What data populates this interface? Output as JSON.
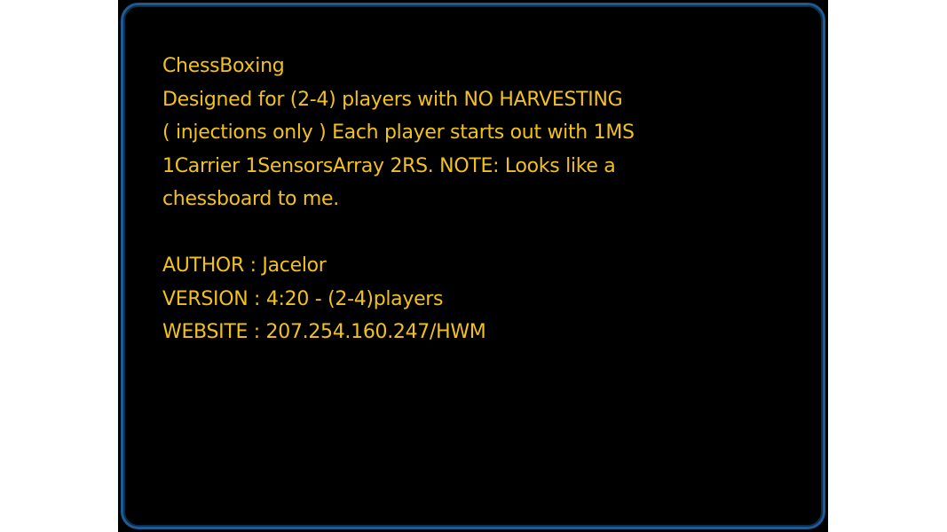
{
  "map_info": {
    "title": "ChessBoxing",
    "description_lines": [
      "Designed for (2-4) players with NO HARVESTING",
      "( injections only ) Each player starts out with 1MS",
      "1Carrier 1SensorsArray 2RS. NOTE: Looks like a",
      "chessboard to me."
    ],
    "author": "AUTHOR  : Jacelor",
    "version": "VERSION  : 4:20 - (2-4)players",
    "website": "WEBSITE  : 207.254.160.247/HWM"
  },
  "colors": {
    "text": "#f2c21b",
    "frame": "#1f5a92",
    "background": "#000000"
  }
}
